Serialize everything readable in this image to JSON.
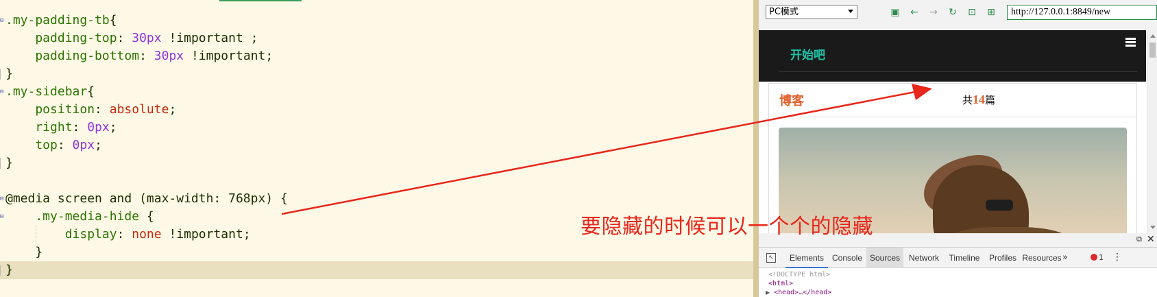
{
  "editor": {
    "lines": [
      {
        "fold": "open",
        "tokens": [
          {
            "t": ".my-padding-tb",
            "c": "c-sel"
          },
          {
            "t": "{",
            "c": "c-plain"
          }
        ]
      },
      {
        "fold": "",
        "tokens": [
          {
            "t": "    padding-top",
            "c": "c-prop"
          },
          {
            "t": ": ",
            "c": "c-plain"
          },
          {
            "t": "30px",
            "c": "c-num"
          },
          {
            "t": " !important ;",
            "c": "c-plain"
          }
        ]
      },
      {
        "fold": "",
        "tokens": [
          {
            "t": "    padding-bottom",
            "c": "c-prop"
          },
          {
            "t": ": ",
            "c": "c-plain"
          },
          {
            "t": "30px",
            "c": "c-num"
          },
          {
            "t": " !important;",
            "c": "c-plain"
          }
        ]
      },
      {
        "fold": "close",
        "tokens": [
          {
            "t": "}",
            "c": "c-plain"
          }
        ]
      },
      {
        "fold": "open",
        "tokens": [
          {
            "t": ".my-sidebar",
            "c": "c-sel"
          },
          {
            "t": "{",
            "c": "c-plain"
          }
        ]
      },
      {
        "fold": "",
        "tokens": [
          {
            "t": "    position",
            "c": "c-prop"
          },
          {
            "t": ": ",
            "c": "c-plain"
          },
          {
            "t": "absolute",
            "c": "c-kw"
          },
          {
            "t": ";",
            "c": "c-plain"
          }
        ]
      },
      {
        "fold": "",
        "tokens": [
          {
            "t": "    right",
            "c": "c-prop"
          },
          {
            "t": ": ",
            "c": "c-plain"
          },
          {
            "t": "0px",
            "c": "c-num"
          },
          {
            "t": ";",
            "c": "c-plain"
          }
        ]
      },
      {
        "fold": "",
        "tokens": [
          {
            "t": "    top",
            "c": "c-prop"
          },
          {
            "t": ": ",
            "c": "c-plain"
          },
          {
            "t": "0px",
            "c": "c-num"
          },
          {
            "t": ";",
            "c": "c-plain"
          }
        ]
      },
      {
        "fold": "close",
        "tokens": [
          {
            "t": "}",
            "c": "c-plain"
          }
        ]
      },
      {
        "fold": "",
        "tokens": []
      },
      {
        "fold": "open",
        "tokens": [
          {
            "t": "@media screen and (max-width: 768px) ",
            "c": "c-at"
          },
          {
            "t": "{",
            "c": "c-plain"
          }
        ]
      },
      {
        "fold": "open",
        "tokens": [
          {
            "t": "    .my-media-hide",
            "c": "c-sel"
          },
          {
            "t": " {",
            "c": "c-plain"
          }
        ]
      },
      {
        "fold": "",
        "guide": true,
        "tokens": [
          {
            "t": "        display",
            "c": "c-prop"
          },
          {
            "t": ": ",
            "c": "c-plain"
          },
          {
            "t": "none",
            "c": "c-kw"
          },
          {
            "t": " !important;",
            "c": "c-plain"
          }
        ]
      },
      {
        "fold": "",
        "tokens": [
          {
            "t": "    }",
            "c": "c-plain"
          }
        ]
      },
      {
        "fold": "close",
        "cursor": true,
        "tokens": [
          {
            "t": "}",
            "c": "c-plain"
          }
        ]
      }
    ]
  },
  "browser": {
    "mode_select": "PC模式",
    "url": "http://127.0.0.1:8849/new",
    "navbar_brand": "开始吧",
    "panel_title": "博客",
    "count_prefix": "共",
    "count_value": "14",
    "count_suffix": "篇"
  },
  "devtools": {
    "tabs": [
      "Elements",
      "Console",
      "Sources",
      "Network",
      "Timeline",
      "Profiles",
      "Resources"
    ],
    "active_tab": "Elements",
    "hover_tab": "Sources",
    "error_count": "1",
    "dom_lines": [
      "<!DOCTYPE html>",
      "<html>",
      "<head>…</head>"
    ]
  },
  "annotation": {
    "note": "要隐藏的时候可以一个个的隐藏",
    "color": "#e8261b"
  },
  "colors": {
    "editor_bg": "#fdf9e6",
    "brand_teal": "#1fc3a6",
    "accent_orange": "#e0622e",
    "toolbar_green": "#2a8a4a"
  }
}
